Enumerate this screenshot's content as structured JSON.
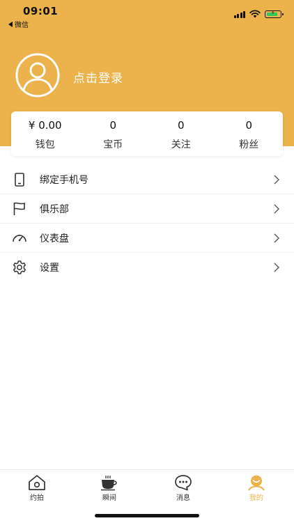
{
  "status_bar": {
    "time": "09:01",
    "back_app": "微信"
  },
  "profile": {
    "login_text": "点击登录"
  },
  "stats": [
    {
      "value": "¥ 0.00",
      "label": "钱包"
    },
    {
      "value": "0",
      "label": "宝币"
    },
    {
      "value": "0",
      "label": "关注"
    },
    {
      "value": "0",
      "label": "粉丝"
    }
  ],
  "menu": [
    {
      "label": "绑定手机号",
      "icon": "phone-icon"
    },
    {
      "label": "俱乐部",
      "icon": "flag-icon"
    },
    {
      "label": "仪表盘",
      "icon": "dashboard-icon"
    },
    {
      "label": "设置",
      "icon": "gear-icon"
    }
  ],
  "tabs": [
    {
      "label": "约拍",
      "icon": "home-icon",
      "active": false
    },
    {
      "label": "瞬间",
      "icon": "coffee-cup-icon",
      "active": false
    },
    {
      "label": "消息",
      "icon": "chat-bubble-icon",
      "active": false
    },
    {
      "label": "我的",
      "icon": "profile-face-icon",
      "active": true
    }
  ],
  "colors": {
    "accent": "#ECB24B",
    "battery": "#35C759"
  }
}
